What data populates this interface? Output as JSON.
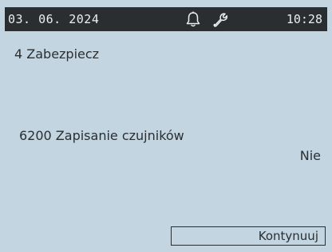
{
  "status_bar": {
    "date": "03. 06. 2024",
    "time": "10:28",
    "icons": [
      "bell-icon",
      "wrench-icon"
    ]
  },
  "menu": {
    "title": "4 Zabezpiecz"
  },
  "parameter": {
    "label": "6200 Zapisanie czujników",
    "value": "Nie"
  },
  "actions": {
    "continue_label": "Kontynuuj"
  },
  "colors": {
    "screen_background": "#c2d5e0",
    "status_bar_background": "#2b2e31",
    "status_bar_text": "#e9eef1",
    "text": "#2a2f33"
  }
}
